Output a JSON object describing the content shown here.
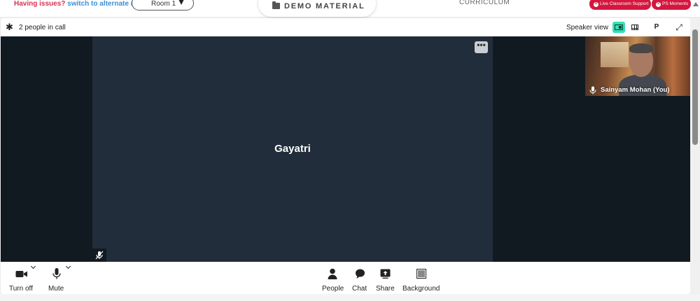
{
  "topbar": {
    "issues_text": "Having issues?",
    "alternate_link": "switch to alternate room",
    "room_select_value": "Room 1",
    "demo_tab_label": "DEMO MATERIAL",
    "curriculum_label": "CURRICULUM",
    "support_button": "Live Classroom Support",
    "moments_button": "PS Moments"
  },
  "call_header": {
    "people_count": "2 people in call",
    "speaker_view_label": "Speaker view",
    "p_button": "P"
  },
  "main_tile": {
    "participant_name": "Gayatri",
    "more_button": "•••"
  },
  "self_tile": {
    "participant_name": "Sainyam Mohan (You)"
  },
  "controls": {
    "camera_label": "Turn off",
    "mic_label": "Mute",
    "people_label": "People",
    "chat_label": "Chat",
    "share_label": "Share",
    "background_label": "Background"
  },
  "colors": {
    "accent_green": "#33e0b5",
    "alert_red": "#d4173f",
    "stage_dark": "#121a21",
    "tile_bg": "#212d3a"
  }
}
